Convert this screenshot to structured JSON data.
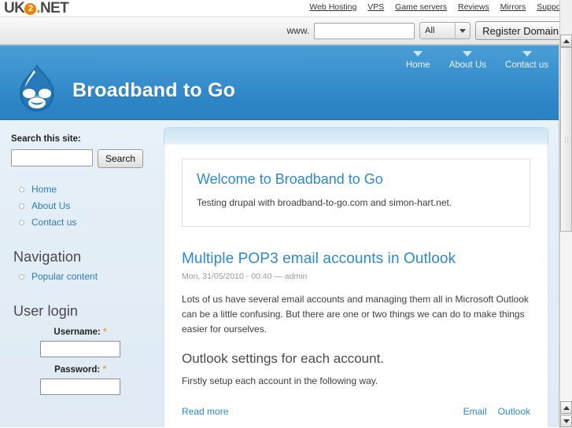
{
  "uk2_bar": {
    "logo": {
      "prefix": "UK",
      "badge": "2",
      "dot": ".",
      "suffix": "NET"
    },
    "links": [
      {
        "label": "Web Hosting"
      },
      {
        "label": "VPS"
      },
      {
        "label": "Game servers"
      },
      {
        "label": "Reviews"
      },
      {
        "label": "Mirrors"
      },
      {
        "label": "Support"
      }
    ]
  },
  "domain_search": {
    "www_label": "www.",
    "domain_value": "",
    "domain_placeholder": "",
    "tld_selected": "All",
    "tld_options": [
      "All"
    ],
    "register_label": "Register Domain"
  },
  "banner": {
    "logo_icon": "drupal-droplet-icon",
    "site_title": "Broadband to Go",
    "nav": [
      {
        "label": "Home"
      },
      {
        "label": "About Us"
      },
      {
        "label": "Contact us"
      }
    ]
  },
  "sidebar": {
    "search": {
      "title": "Search this site:",
      "value": "",
      "placeholder": "",
      "button_label": "Search"
    },
    "menu": [
      {
        "label": "Home"
      },
      {
        "label": "About Us"
      },
      {
        "label": "Contact us"
      }
    ],
    "navigation": {
      "heading": "Navigation",
      "items": [
        {
          "label": "Popular content"
        }
      ]
    },
    "user_login": {
      "heading": "User login",
      "username_label": "Username:",
      "username_value": "",
      "password_label": "Password:",
      "password_value": "",
      "required_marker": "*"
    }
  },
  "content": {
    "welcome": {
      "title": "Welcome to Broadband to Go",
      "text": "Testing drupal with broadband-to-go.com and simon-hart.net."
    },
    "node": {
      "title": "Multiple POP3 email accounts in Outlook",
      "meta": "Mon, 31/05/2010 - 00:40 — admin",
      "body": "Lots of us have several email accounts and managing them all in Microsoft Outlook can be a little confusing. But there are one or two things we can do to make things easier for ourselves.",
      "subheading": "Outlook settings for each account.",
      "subtext": "Firstly setup each account in the following way.",
      "read_more": "Read more",
      "taxonomy": [
        {
          "label": "Email"
        },
        {
          "label": "Outlook"
        }
      ]
    }
  },
  "colors": {
    "banner_blue": "#2e86c6",
    "link_blue": "#2c8ad0",
    "sidebar_link": "#2c7bbd",
    "accent_orange": "#f08000",
    "required_orange": "#f0a030"
  },
  "scrollbar": {
    "up_icon": "scroll-up-arrow-icon",
    "down_icon": "scroll-down-arrow-icon"
  }
}
